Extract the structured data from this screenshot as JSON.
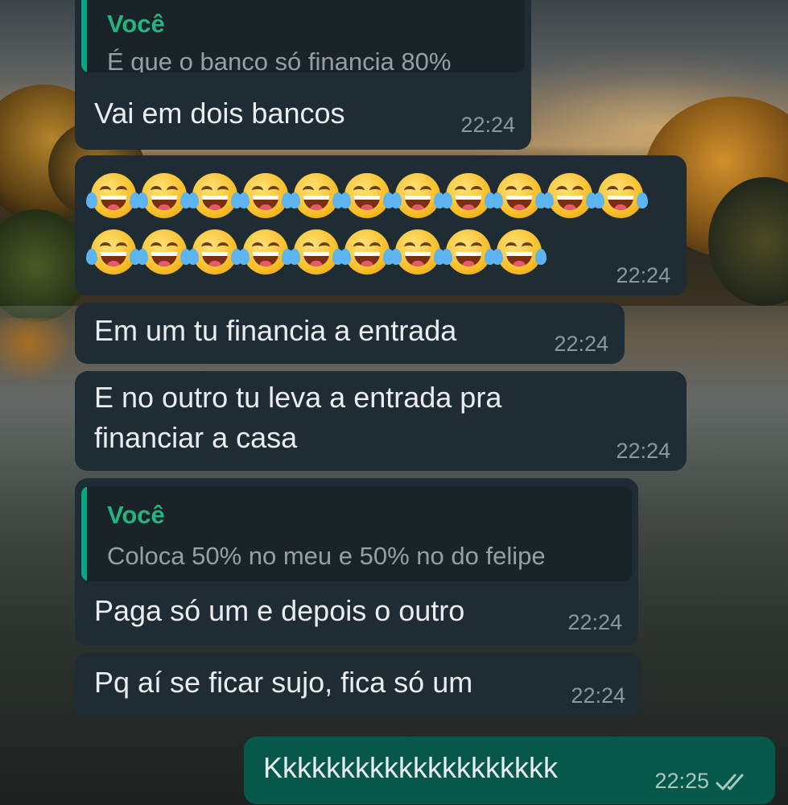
{
  "messages": [
    {
      "quote_author": "Você",
      "quote_text": "É que o banco só financia 80%",
      "text": "Vai em dois bancos",
      "time": "22:24"
    },
    {
      "emoji": "😂",
      "emoji_row1_count": 11,
      "emoji_row2_count": 9,
      "time": "22:24"
    },
    {
      "text": "Em um tu financia a entrada",
      "time": "22:24"
    },
    {
      "line1": "E no outro tu leva a entrada pra",
      "line2": "financiar a casa",
      "time": "22:24"
    },
    {
      "quote_author": "Você",
      "quote_text": "Coloca 50% no meu e 50% no do felipe",
      "text": "Paga só um e depois o outro",
      "time": "22:24"
    },
    {
      "text": "Pq aí se ficar sujo, fica só um",
      "time": "22:24"
    },
    {
      "text": "Kkkkkkkkkkkkkkkkkkkk",
      "time": "22:25",
      "status_icon": "double-check-icon"
    }
  ],
  "colors": {
    "incoming_bubble": "#1f2c33",
    "outgoing_bubble": "#06594a",
    "quote_accent": "#06a884",
    "quote_author": "#25b47f"
  }
}
